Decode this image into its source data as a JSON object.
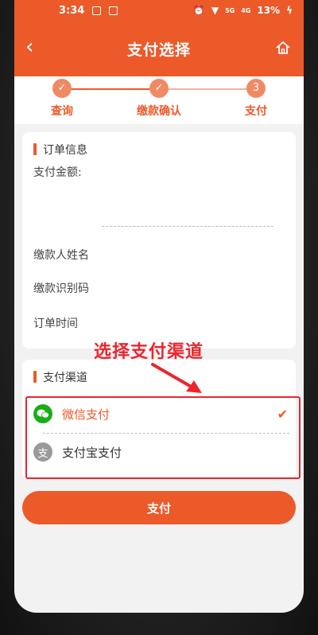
{
  "status_bar": {
    "time": "3:34",
    "signal": "5G",
    "network": "4G",
    "battery": "13%"
  },
  "nav": {
    "title": "支付选择",
    "back_glyph": "‹"
  },
  "steps": [
    {
      "label": "查询",
      "glyph": "✓"
    },
    {
      "label": "缴款确认",
      "glyph": "✓"
    },
    {
      "label": "支付",
      "glyph": "3"
    }
  ],
  "order": {
    "section_title": "订单信息",
    "amount_label": "支付金额:",
    "payer_name_label": "缴款人姓名",
    "id_code_label": "缴款识别码",
    "time_label": "订单时间"
  },
  "channels": {
    "section_title": "支付渠道",
    "items": [
      {
        "label": "微信支付",
        "selected": true,
        "icon": "wechat-icon",
        "color": "#1aad19"
      },
      {
        "label": "支付宝支付",
        "selected": false,
        "icon": "alipay-icon",
        "color": "#9a9a9a"
      }
    ],
    "check_glyph": "✔"
  },
  "pay_button": "支付",
  "annotation": "选择支付渠道",
  "colors": {
    "accent": "#ec5a2a",
    "highlight_red": "#e8262e"
  }
}
